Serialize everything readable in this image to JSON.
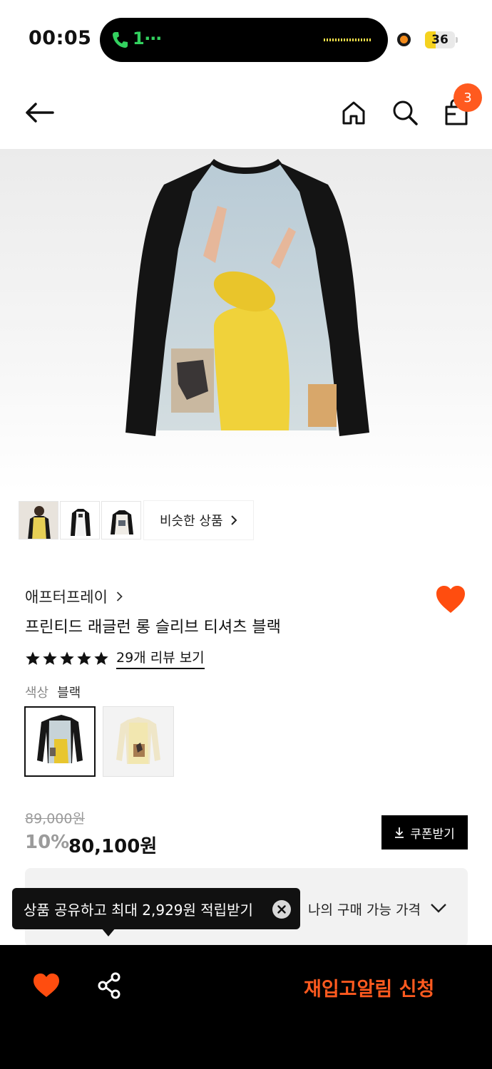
{
  "status_bar": {
    "time": "00:05",
    "call_text": "1⋯",
    "battery": "36",
    "battery_level": 0.36
  },
  "nav": {
    "cart_count": "3"
  },
  "gallery": {
    "similar_label": "비슷한 상품"
  },
  "product": {
    "brand": "애프터프레이",
    "title": "프린티드 래글런 롱 슬리브 티셔츠 블랙",
    "rating": 5,
    "review_link": "29개 리뷰 보기",
    "color_label": "색상",
    "color_value": "블랙"
  },
  "price": {
    "original": "89,000원",
    "discount": "10%",
    "current": "80,100원",
    "coupon_label": "쿠폰받기",
    "purchasable_label": "나의 구매 가능 가격"
  },
  "tooltip": {
    "text": "상품 공유하고 최대 2,929원 적립받기"
  },
  "bottom_bar": {
    "restock_label": "재입고알림 신청"
  },
  "colors": {
    "accent": "#ff5a1f",
    "dark": "#000000"
  },
  "icons": [
    "back-arrow-icon",
    "home-icon",
    "search-icon",
    "shopping-bag-icon",
    "heart-icon",
    "share-icon",
    "download-icon",
    "chevron-down-icon",
    "close-icon",
    "star-icon",
    "phone-icon"
  ]
}
